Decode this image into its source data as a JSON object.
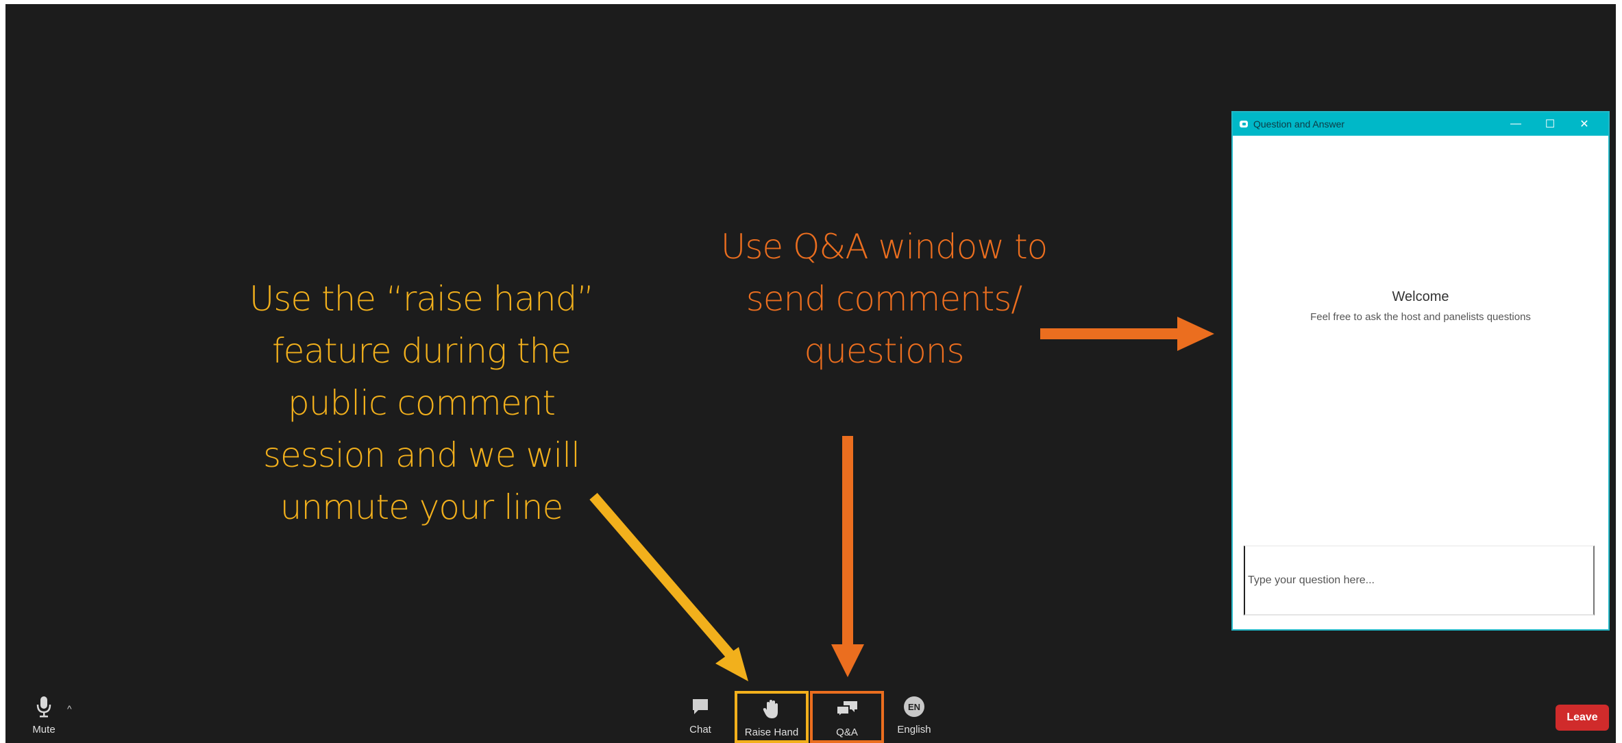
{
  "annotations": {
    "raise_hand_lines": [
      "Use the “raise hand”",
      "feature during the",
      "public comment",
      "session and we will",
      "unmute your line"
    ],
    "qa_lines": [
      "Use Q&A window to",
      "send comments/",
      "questions"
    ],
    "raise_color": "#f2b01c",
    "qa_color": "#eb6e1f"
  },
  "qa_window": {
    "title": "Question and Answer",
    "minimize": "—",
    "maximize": "☐",
    "close": "✕",
    "welcome": "Welcome",
    "subtitle": "Feel free to ask the host and panelists questions",
    "input_placeholder": "Type your question here...",
    "accent": "#00b8c8"
  },
  "toolbar": {
    "mute": {
      "label": "Mute",
      "icon": "microphone-icon"
    },
    "mute_caret": "^",
    "chat": {
      "label": "Chat",
      "icon": "chat-bubble-icon"
    },
    "raise_hand": {
      "label": "Raise Hand",
      "icon": "hand-icon"
    },
    "qa": {
      "label": "Q&A",
      "icon": "qa-bubbles-icon"
    },
    "language": {
      "label": "English",
      "badge": "EN",
      "icon": "language-badge-icon"
    },
    "leave": "Leave",
    "leave_color": "#d02b2b"
  }
}
